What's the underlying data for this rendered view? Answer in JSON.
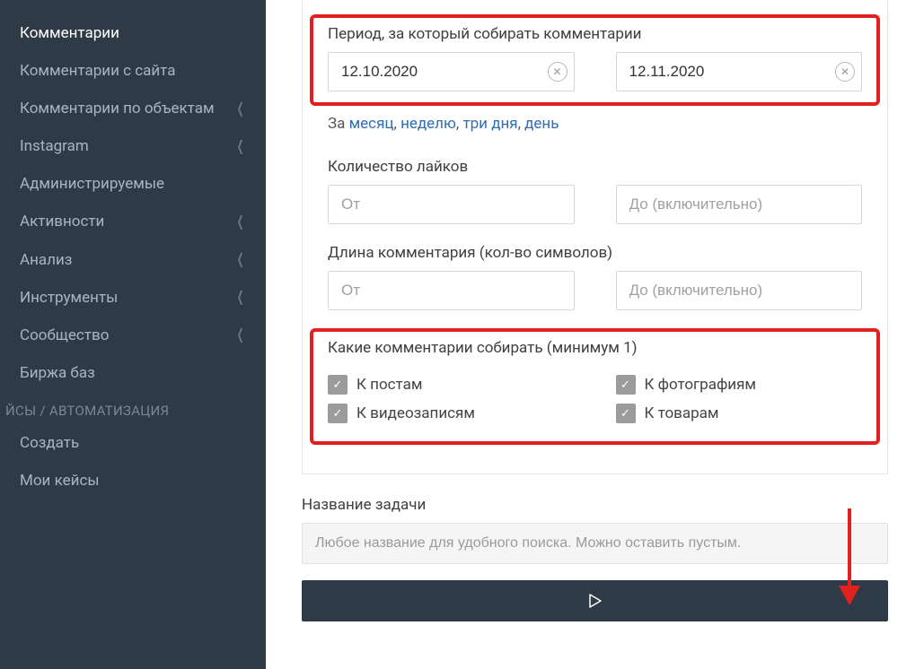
{
  "sidebar": {
    "items": [
      {
        "label": "Комментарии",
        "active": true,
        "expandable": false
      },
      {
        "label": "Комментарии с сайта",
        "active": false,
        "expandable": false
      },
      {
        "label": "Комментарии по объектам",
        "active": false,
        "expandable": true
      },
      {
        "label": "Instagram",
        "active": false,
        "expandable": true
      },
      {
        "label": "Администрируемые",
        "active": false,
        "expandable": false
      },
      {
        "label": "Активности",
        "active": false,
        "expandable": true
      },
      {
        "label": "Анализ",
        "active": false,
        "expandable": true
      },
      {
        "label": "Инструменты",
        "active": false,
        "expandable": true
      },
      {
        "label": "Сообщество",
        "active": false,
        "expandable": true
      },
      {
        "label": "Биржа баз",
        "active": false,
        "expandable": false
      }
    ],
    "section_label": "ЙСЫ / АВТОМАТИЗАЦИЯ",
    "section_items": [
      {
        "label": "Создать"
      },
      {
        "label": "Мои кейсы"
      }
    ]
  },
  "period": {
    "label": "Период, за который собирать комментарии",
    "from": "12.10.2020",
    "to": "12.11.2020",
    "quick_prefix": "За ",
    "quick_links": {
      "month": "месяц",
      "week": "неделю",
      "three_days": "три дня",
      "day": "день"
    }
  },
  "likes": {
    "label": "Количество лайков",
    "from_placeholder": "От",
    "to_placeholder": "До (включительно)"
  },
  "length": {
    "label": "Длина комментария (кол-во символов)",
    "from_placeholder": "От",
    "to_placeholder": "До (включительно)"
  },
  "types": {
    "label": "Какие комментарии собирать (минимум 1)",
    "posts": "К постам",
    "photos": "К фотографиям",
    "videos": "К видеозаписям",
    "goods": "К товарам"
  },
  "task": {
    "label": "Название задачи",
    "placeholder": "Любое название для удобного поиска. Можно оставить пустым."
  },
  "punctuation": {
    "comma_space": ", "
  }
}
